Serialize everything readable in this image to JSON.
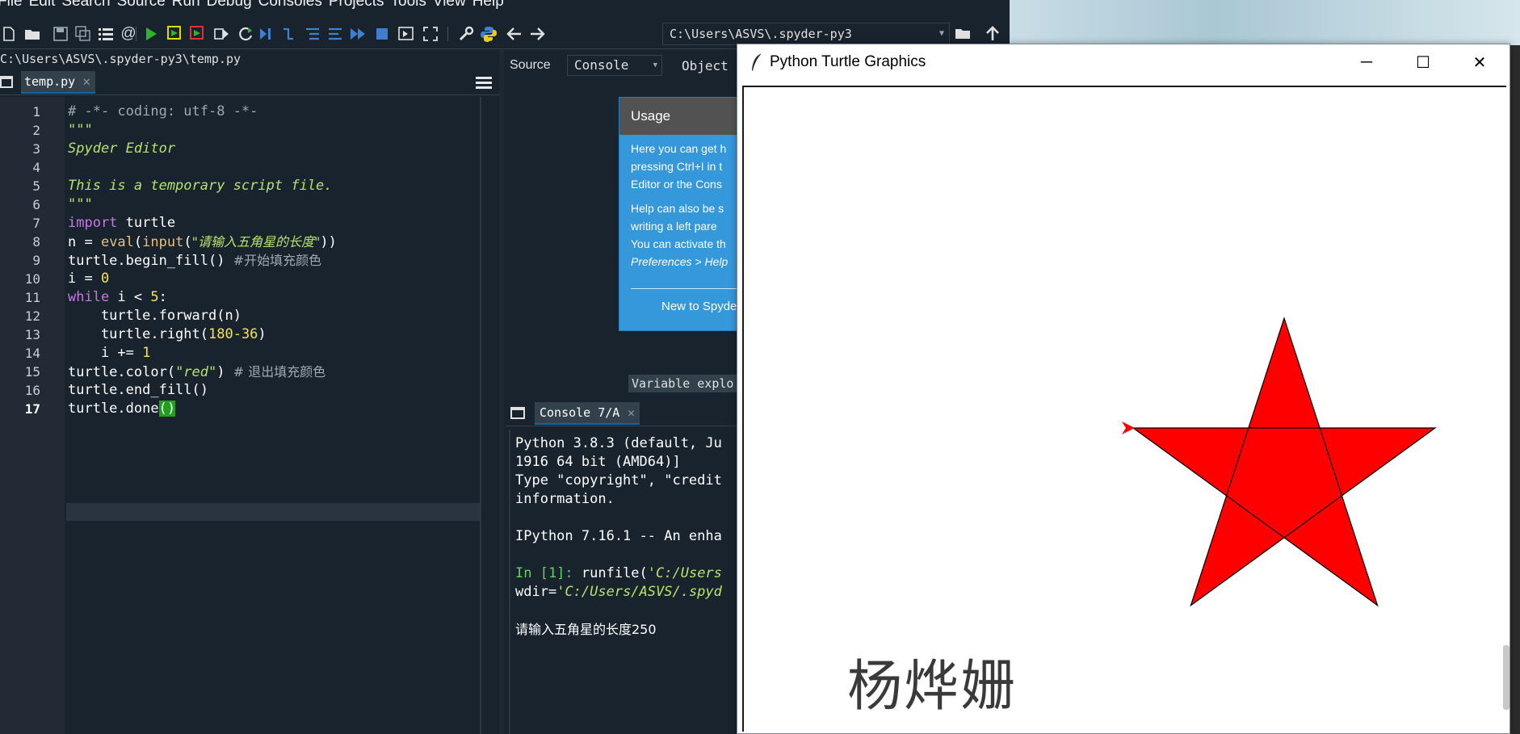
{
  "menubar": {
    "items": [
      "File",
      "Edit",
      "Search",
      "Source",
      "Run",
      "Debug",
      "Consoles",
      "Projects",
      "Tools",
      "View",
      "Help"
    ]
  },
  "toolbar": {
    "icons": [
      "new-file-icon",
      "open-file-icon",
      "save-icon",
      "save-all-icon",
      "outline-icon",
      "at-icon",
      "run-icon",
      "run-cell-icon",
      "run-cell-advance-icon",
      "run-selection-icon",
      "rerun-icon",
      "debug-icon",
      "step-icon",
      "step-into-icon",
      "step-return-icon",
      "continue-icon",
      "stop-icon",
      "maximize-pane-icon",
      "fullscreen-icon",
      "preferences-icon",
      "python-path-icon",
      "back-icon",
      "forward-icon",
      "browse-dir-icon",
      "parent-dir-icon"
    ],
    "working_directory": "C:\\Users\\ASVS\\.spyder-py3"
  },
  "editor": {
    "path": "C:\\Users\\ASVS\\.spyder-py3\\temp.py",
    "tab_label": "temp.py",
    "current_line": 17,
    "line_numbers": [
      "1",
      "2",
      "3",
      "4",
      "5",
      "6",
      "7",
      "8",
      "9",
      "10",
      "11",
      "12",
      "13",
      "14",
      "15",
      "16",
      "17"
    ],
    "code": {
      "l1": "# -*- coding: utf-8 -*-",
      "l2": "\"\"\"",
      "l3": "Spyder Editor",
      "l4": "",
      "l5": "This is a temporary script file.",
      "l6": "\"\"\"",
      "l7_kw": "import",
      "l7_rest": " turtle",
      "l8_a": "n = ",
      "l8_eval": "eval",
      "l8_b": "(",
      "l8_input": "input",
      "l8_c": "(",
      "l8_str": "\"请输入五角星的长度\"",
      "l8_d": "))",
      "l9_code": "turtle.begin_fill() ",
      "l9_cmt": "#开始填充颜色",
      "l10_a": "i = ",
      "l10_num": "0",
      "l11_kw": "while",
      "l11_a": " i < ",
      "l11_num": "5",
      "l11_b": ":",
      "l12": "    turtle.forward(n)",
      "l13_a": "    turtle.right(",
      "l13_num": "180-36",
      "l13_b": ")",
      "l14_a": "    i += ",
      "l14_num": "1",
      "l15_a": "turtle.color(",
      "l15_str": "\"red\"",
      "l15_b": ") ",
      "l15_cmt": "# 退出填充颜色",
      "l16": "turtle.end_fill()",
      "l17_a": "turtle.done",
      "l17_paren": "()"
    }
  },
  "help": {
    "source_label": "Source",
    "source_value": "Console",
    "object_label": "Object",
    "usage_title": "Usage",
    "usage_lines": [
      "Here you can get h",
      "pressing Ctrl+I in t",
      "Editor or the Cons"
    ],
    "usage_lines2": [
      "Help can also be s",
      "writing a left pare",
      "You can activate th",
      "Preferences > Help"
    ],
    "usage_new": "New to Spyde",
    "variable_explorer_tab": "Variable explo"
  },
  "console": {
    "tab_label": "Console 7/A",
    "lines": {
      "c1": "Python 3.8.3 (default, Ju",
      "c2": "1916 64 bit (AMD64)]",
      "c3": "Type \"copyright\", \"credit",
      "c4": "information.",
      "c5": "IPython 7.16.1 -- An enha",
      "c6_prompt": "In [1]: ",
      "c6_a": "runfile(",
      "c6_str": "'C:/Users",
      "c7_a": "wdir=",
      "c7_str": "'C:/Users/ASVS/.spyd",
      "c8": "请输入五角星的长度250"
    }
  },
  "turtle_window": {
    "title": "Python Turtle Graphics",
    "minimize": "─",
    "maximize": "☐",
    "close": "✕",
    "written_text": "杨烨姗",
    "star_fill": "#ff0000",
    "star_outline": "#000000",
    "turtle_color": "#ff0000"
  },
  "colors": {
    "spyder_bg": "#19232d",
    "tab_active": "#32414b",
    "usage_blue": "#3498db"
  }
}
